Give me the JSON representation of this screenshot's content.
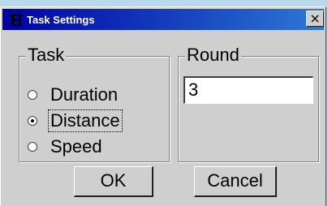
{
  "window": {
    "title": "Task Settings",
    "close_glyph": "×",
    "icon": "task-app-icon"
  },
  "task_group": {
    "label": "Task",
    "options": [
      {
        "label": "Duration",
        "checked": false
      },
      {
        "label": "Distance",
        "checked": true
      },
      {
        "label": "Speed",
        "checked": false
      }
    ]
  },
  "round_group": {
    "label": "Round",
    "value": "3"
  },
  "buttons": {
    "ok_label": "OK",
    "cancel_label": "Cancel"
  },
  "colors": {
    "title_bar": "#0000a8",
    "face": "#cfcfcf",
    "background": "#b8d8ec"
  }
}
